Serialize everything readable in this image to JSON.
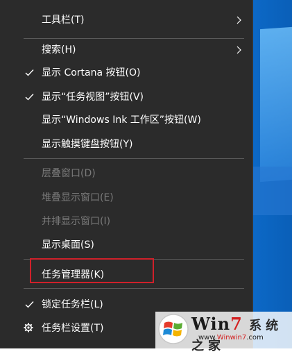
{
  "context_menu": {
    "items": [
      {
        "label": "工具栏(T)",
        "checked": false,
        "submenu": true,
        "disabled": false
      },
      {
        "label": "搜索(H)",
        "checked": false,
        "submenu": true,
        "disabled": false
      },
      {
        "label": "显示 Cortana 按钮(O)",
        "checked": true,
        "submenu": false,
        "disabled": false
      },
      {
        "label": "显示“任务视图”按钮(V)",
        "checked": true,
        "submenu": false,
        "disabled": false
      },
      {
        "label": "显示“Windows Ink 工作区”按钮(W)",
        "checked": false,
        "submenu": false,
        "disabled": false
      },
      {
        "label": "显示触摸键盘按钮(Y)",
        "checked": false,
        "submenu": false,
        "disabled": false
      },
      {
        "label": "层叠窗口(D)",
        "checked": false,
        "submenu": false,
        "disabled": true
      },
      {
        "label": "堆叠显示窗口(E)",
        "checked": false,
        "submenu": false,
        "disabled": true
      },
      {
        "label": "并排显示窗口(I)",
        "checked": false,
        "submenu": false,
        "disabled": true
      },
      {
        "label": "显示桌面(S)",
        "checked": false,
        "submenu": false,
        "disabled": false
      },
      {
        "label": "任务管理器(K)",
        "checked": false,
        "submenu": false,
        "disabled": false,
        "highlighted": true
      },
      {
        "label": "锁定任务栏(L)",
        "checked": true,
        "submenu": false,
        "disabled": false
      },
      {
        "label": "任务栏设置(T)",
        "checked": false,
        "submenu": false,
        "disabled": false,
        "icon": "gear-icon"
      }
    ]
  },
  "watermark": {
    "brand_prefix": "Win",
    "brand_number": "7",
    "site_prefix": "www.",
    "site_highlight": "Winwin7",
    "site_suffix": ".com",
    "partial_text": "系统之家"
  },
  "colors": {
    "menu_background": "#2b2b2b",
    "menu_text": "#ffffff",
    "disabled_text": "#7a7a7a",
    "separator": "#5a5a5a",
    "highlight_box": "#d0202a",
    "desktop_blue": "#0b63c0"
  }
}
